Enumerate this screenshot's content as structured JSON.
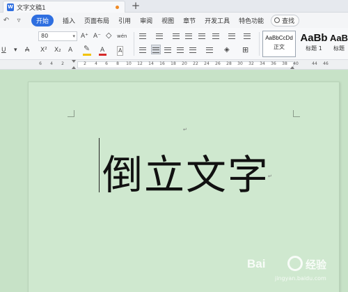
{
  "titlebar": {
    "doc_icon": "W",
    "doc_title": "文字文稿1",
    "new_tab_icon": "+"
  },
  "menubar": {
    "undo_icon": "↶",
    "dropdown_icon": "▿",
    "items": [
      "开始",
      "插入",
      "页面布局",
      "引用",
      "审阅",
      "视图",
      "章节",
      "开发工具",
      "特色功能"
    ],
    "search_label": "查找"
  },
  "ribbon": {
    "font_size": "80",
    "font_row": [
      "A⁺",
      "A⁻",
      "◇",
      "wén"
    ],
    "format_row": [
      "U",
      "A",
      "X²",
      "X₂",
      "A",
      "A",
      "A"
    ],
    "highlight_color": "#f2c200",
    "font_color": "#d62a2a",
    "styles": [
      {
        "sample": "AaBbCcDd",
        "name": "正文"
      },
      {
        "sample": "AaBb",
        "name": "标题 1"
      },
      {
        "sample": "AaB",
        "name": "标题"
      }
    ]
  },
  "ruler": {
    "ticks": [
      "6",
      "4",
      "2",
      "2",
      "4",
      "6",
      "8",
      "10",
      "12",
      "14",
      "16",
      "18",
      "20",
      "22",
      "24",
      "26",
      "28",
      "30",
      "32",
      "34",
      "36",
      "38",
      "40",
      "44",
      "46"
    ]
  },
  "document": {
    "text": "倒立文字",
    "para_mark": "↵"
  },
  "watermark": {
    "brand": "Bai",
    "brand_tail": "经验",
    "sub": "jingyan.baidu.com"
  }
}
